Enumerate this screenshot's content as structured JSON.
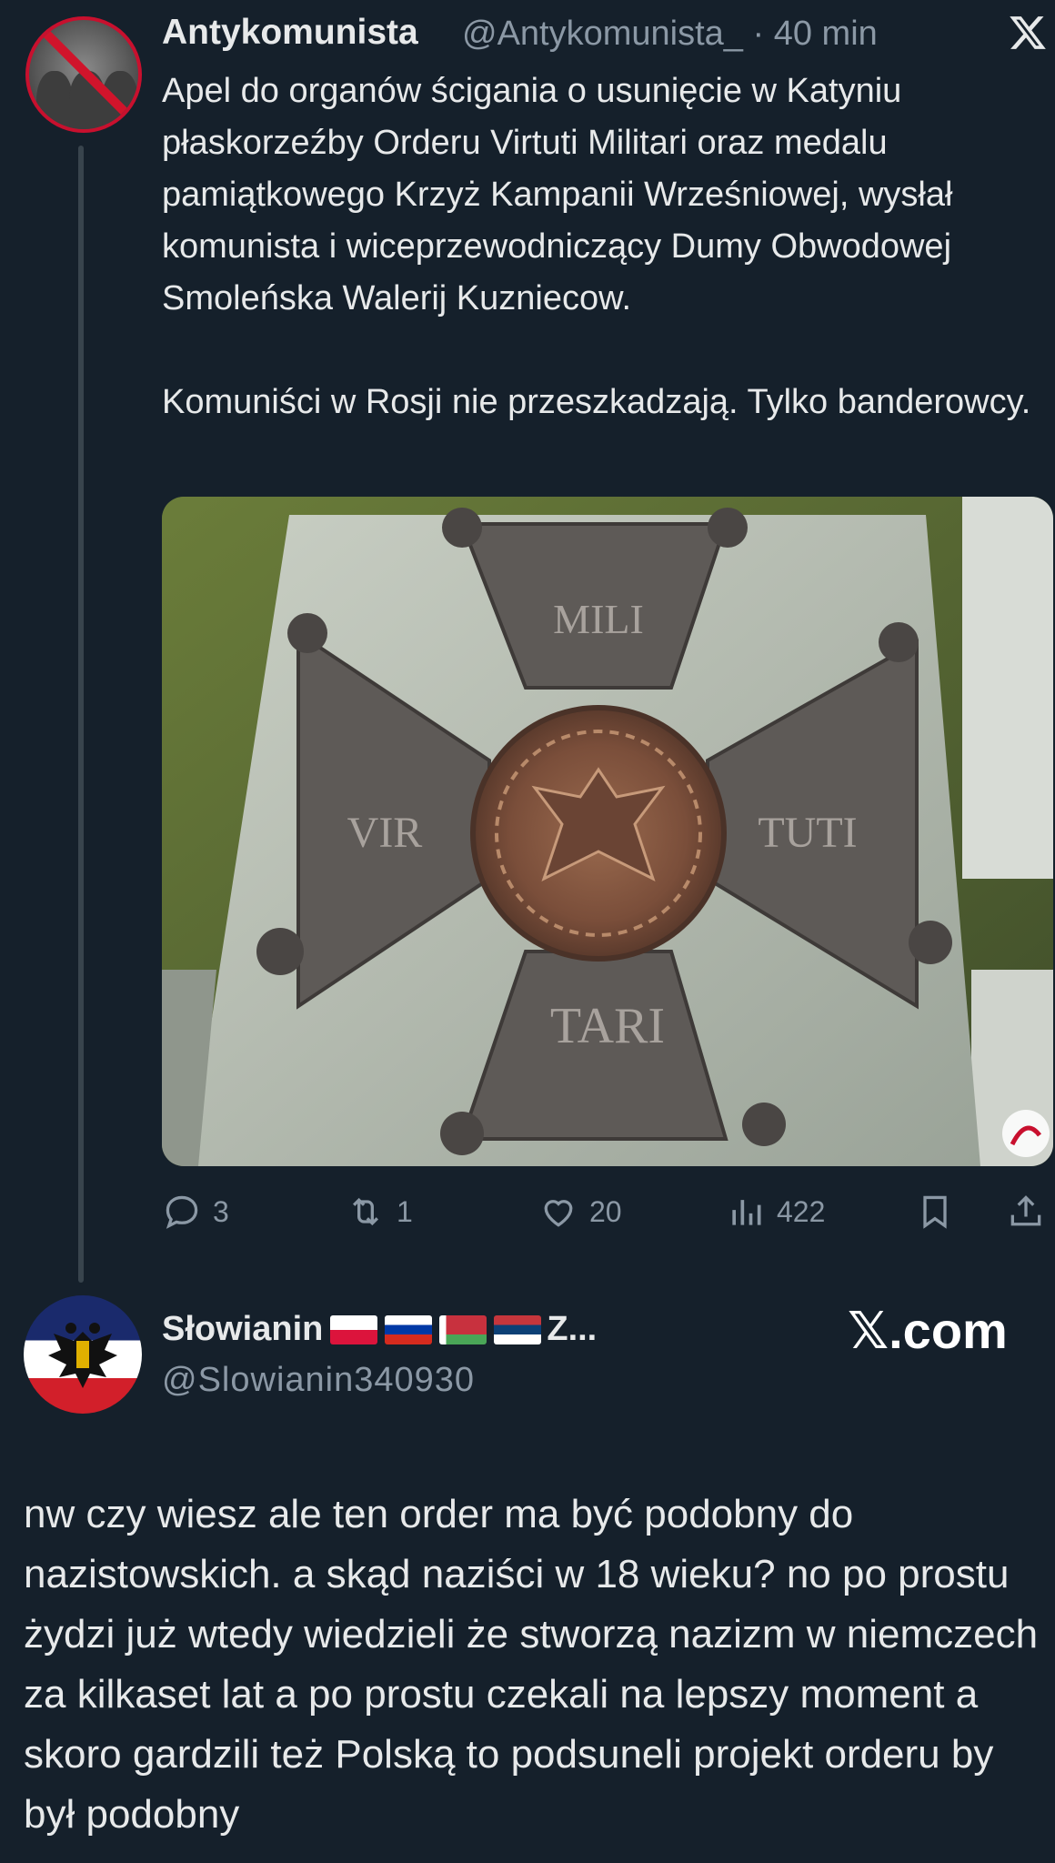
{
  "tweet": {
    "author_name": "Antykomunista",
    "author_handle": "@Antykomunista_",
    "separator": " · ",
    "time": "40 min",
    "text": "Apel do organów ścigania o usunięcie w Katyniu płaskorzeźby Orderu Virtuti Militari oraz medalu pamiątkowego Krzyż Kampanii Wrześniowej, wysłał komunista i wiceprzewodniczący Dumy Obwodowej Smoleńska Walerij Kuzniecow.\n\nKomuniści w Rosji nie przeszkadzają. Tylko banderowcy.",
    "media": {
      "inscriptions": {
        "top": "MILI",
        "left": "VIR",
        "right": "TUTI",
        "bottom": "TARI"
      }
    },
    "actions": {
      "replies": "3",
      "reposts": "1",
      "likes": "20",
      "views": "422"
    }
  },
  "reply": {
    "author_name": "Słowianin",
    "name_suffix": "Z...",
    "author_handle": "@Slowianin340930",
    "brand": "𝕏.com",
    "text": "nw czy wiesz ale ten order ma być podobny do nazistowskich. a skąd naziści w 18 wieku? no po prostu żydzi już wtedy wiedzieli że stworzą nazizm w niemczech za kilkaset lat a po prostu czekali na lepszy moment a skoro gardzili też Polską to podsuneli projekt orderu by był podobny"
  },
  "colors": {
    "background": "#15202b",
    "text": "#e7e9ea",
    "muted": "#8b98a5"
  }
}
